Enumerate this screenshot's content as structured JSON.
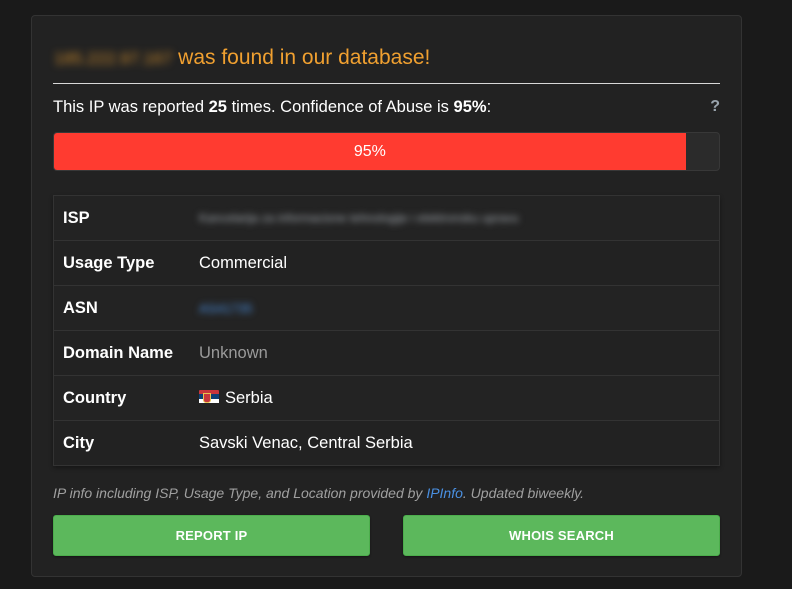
{
  "header": {
    "ip_address": "185.222.97.167",
    "found_text": "was found in our database!"
  },
  "report": {
    "prefix": "This IP was reported",
    "count": "25",
    "middle": "times. Confidence of Abuse is",
    "confidence": "95%",
    "suffix": ":",
    "help": "?"
  },
  "progress": {
    "value": 0.95,
    "label": "95%",
    "color": "#ff3b30"
  },
  "details": {
    "isp_label": "ISP",
    "isp_value": "Kancelarija za informacione tehnologije i elektronsku upravu",
    "usage_label": "Usage Type",
    "usage_value": "Commercial",
    "asn_label": "ASN",
    "asn_value": "AS41735",
    "domain_label": "Domain Name",
    "domain_value": "Unknown",
    "country_label": "Country",
    "country_value": "Serbia",
    "country_flag": "serbia-flag-icon",
    "city_label": "City",
    "city_value": "Savski Venac, Central Serbia"
  },
  "footnote": {
    "prefix": "IP info including ISP, Usage Type, and Location provided by",
    "link": "IPInfo",
    "suffix": ". Updated biweekly."
  },
  "buttons": {
    "report": "REPORT IP",
    "whois": "WHOIS SEARCH",
    "color": "#5cb85c"
  }
}
